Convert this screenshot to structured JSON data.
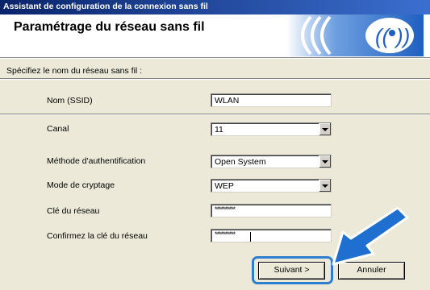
{
  "window": {
    "title": "Assistant de configuration de la connexion sans fil"
  },
  "header": {
    "title": "Paramétrage du réseau sans fil",
    "logo_icon": "wireless-signal-icon"
  },
  "intro": "Spécifiez le nom du réseau sans fil :",
  "form": {
    "ssid": {
      "label": "Nom (SSID)",
      "value": "WLAN"
    },
    "channel": {
      "label": "Canal",
      "value": "11"
    },
    "auth": {
      "label": "Méthode d'authentification",
      "value": "Open System"
    },
    "encryption": {
      "label": "Mode de cryptage",
      "value": "WEP"
    },
    "key": {
      "label": "Clé du réseau",
      "value": "**********"
    },
    "confirm_key": {
      "label": "Confirmez la clé du réseau",
      "value": "**********"
    }
  },
  "buttons": {
    "next": "Suivant >",
    "cancel": "Annuler"
  },
  "colors": {
    "title_bar": "#0a246a",
    "dialog_bg": "#ece9d8",
    "highlight": "#2e7fd1",
    "arrow": "#1e6fd0"
  }
}
